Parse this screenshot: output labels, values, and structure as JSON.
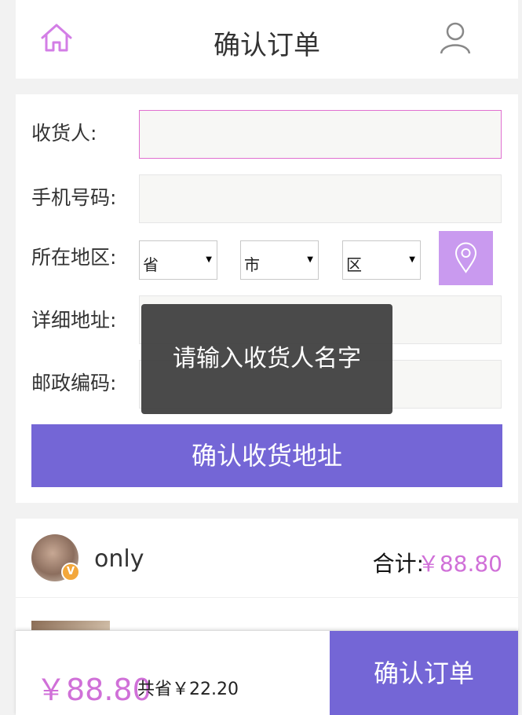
{
  "header": {
    "title": "确认订单",
    "home_icon": "home-icon",
    "user_icon": "user-icon"
  },
  "form": {
    "receiver_label": "收货人:",
    "phone_label": "手机号码:",
    "region_label": "所在地区:",
    "province_value": "省",
    "city_value": "市",
    "district_value": "区",
    "detail_label": "详细地址:",
    "postcode_label": "邮政编码:",
    "confirm_address_label": "确认收货地址"
  },
  "toast": {
    "message": "请输入收货人名字"
  },
  "order": {
    "shop_name": "only",
    "vip_badge": "V",
    "total_label": "合计:",
    "total_value": "￥88.80"
  },
  "footer": {
    "price": "￥88.80",
    "save_text": "共省￥22.20",
    "confirm_order_label": "确认订单"
  },
  "colors": {
    "accent": "#7466d6",
    "price": "#d070d8",
    "locate": "#c99aef"
  }
}
